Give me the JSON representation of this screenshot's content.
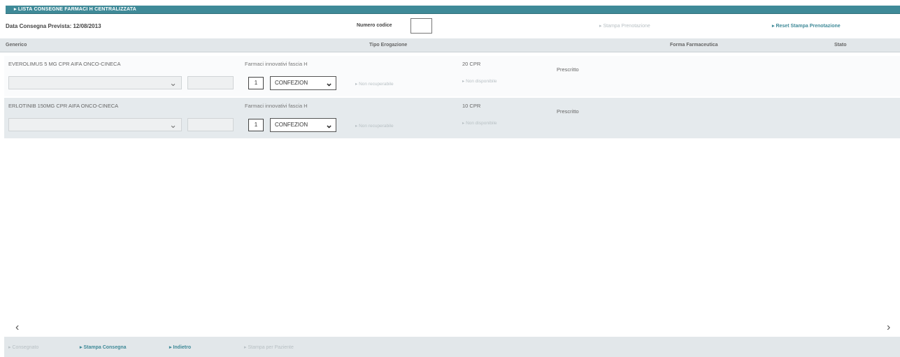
{
  "header": {
    "title": "▸ LISTA CONSEGNE FARMACI H CENTRALIZZATA"
  },
  "subheader": {
    "date_label": "Data Consegna Prevista: 12/08/2013",
    "codice_label": "Numero codice",
    "codice_value": "",
    "stampa_prenotazione": "▸ Stampa Prenotazione",
    "reset_stampa_prenotazione": "▸ Reset Stampa Prenotazione"
  },
  "columns": {
    "generico": "Generico",
    "tipo_erogazione": "Tipo Erogazione",
    "forma_farmaceutica": "Forma Farmaceutica",
    "stato": "Stato"
  },
  "rows": [
    {
      "name": "EVEROLIMUS 5 MG CPR AIFA ONCO-CINECA",
      "tipo": "Farmaci innovativi fascia H",
      "qty": "1",
      "confezione": "CONFEZION",
      "link1": "▸ Non recuperabile",
      "link2": "▸ Non disponibile",
      "quantita": "20 CPR",
      "stato": "Prescritto"
    },
    {
      "name": "ERLOTINIB 150MG CPR AIFA ONCO-CINECA",
      "tipo": "Farmaci innovativi fascia H",
      "qty": "1",
      "confezione": "CONFEZION",
      "link1": "▸ Non recuperabile",
      "link2": "▸ Non disponibile",
      "quantita": "10 CPR",
      "stato": "Prescritto"
    }
  ],
  "scroll": {
    "left": "‹",
    "right": "›"
  },
  "footer": {
    "consegnato": "▸ Consegnato",
    "stampa_consegna": "▸ Stampa Consegna",
    "indietro": "▸ Indietro",
    "stampa_paziente": "▸ Stampa per Paziente"
  },
  "colors": {
    "accent": "#3f8a98",
    "header_bg": "#e2e7ea",
    "disabled": "#b8c0c4"
  }
}
